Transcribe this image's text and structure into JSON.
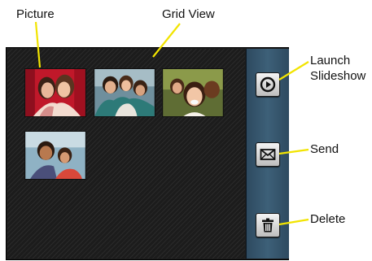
{
  "callouts": {
    "picture": "Picture",
    "grid_view": "Grid View",
    "launch_line1": "Launch",
    "launch_line2": "Slideshow",
    "send": "Send",
    "delete": "Delete"
  },
  "icons": {
    "launch_slideshow": "play-circle-icon",
    "send": "envelope-icon",
    "delete": "trash-icon"
  },
  "thumbnails": [
    {
      "name": "two-girls-hugging-photo"
    },
    {
      "name": "family-group-photo"
    },
    {
      "name": "laughing-girl-photo"
    },
    {
      "name": "father-and-child-photo"
    }
  ],
  "colors": {
    "callout_line": "#f2e400",
    "sidebar": "#3d6078",
    "grid_background": "#202020"
  }
}
